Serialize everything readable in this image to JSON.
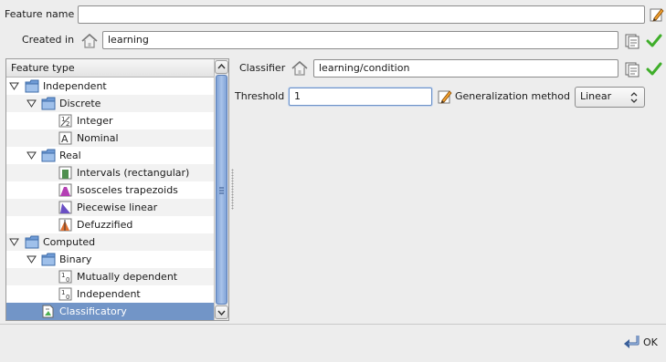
{
  "form": {
    "feature_name_label": "Feature name",
    "feature_name_value": "",
    "created_in_label": "Created in",
    "created_in_value": "learning"
  },
  "tree": {
    "header": "Feature type",
    "items": [
      {
        "label": "Independent",
        "icon": "folder-icon",
        "expanded": true
      },
      {
        "label": "Discrete",
        "icon": "folder-icon",
        "expanded": true
      },
      {
        "label": "Integer",
        "icon": "integer-icon"
      },
      {
        "label": "Nominal",
        "icon": "nominal-icon"
      },
      {
        "label": "Real",
        "icon": "folder-icon",
        "expanded": true
      },
      {
        "label": "Intervals (rectangular)",
        "icon": "intervals-icon"
      },
      {
        "label": "Isosceles trapezoids",
        "icon": "trapezoid-icon"
      },
      {
        "label": "Piecewise linear",
        "icon": "piecewise-icon"
      },
      {
        "label": "Defuzzified",
        "icon": "defuzzified-icon"
      },
      {
        "label": "Computed",
        "icon": "folder-icon",
        "expanded": true
      },
      {
        "label": "Binary",
        "icon": "folder-icon",
        "expanded": true
      },
      {
        "label": "Mutually dependent",
        "icon": "binary-icon"
      },
      {
        "label": "Independent",
        "icon": "binary-icon"
      },
      {
        "label": "Classificatory",
        "icon": "classificatory-icon",
        "selected": true
      }
    ]
  },
  "details": {
    "classifier_label": "Classifier",
    "classifier_value": "learning/condition",
    "threshold_label": "Threshold",
    "threshold_value": "1",
    "generalization_label": "Generalization method",
    "generalization_value": "Linear"
  },
  "footer": {
    "ok_label": "OK"
  },
  "colors": {
    "selection": "#7295c7",
    "folder": "#6f9bd6",
    "check": "#3fae2a"
  }
}
